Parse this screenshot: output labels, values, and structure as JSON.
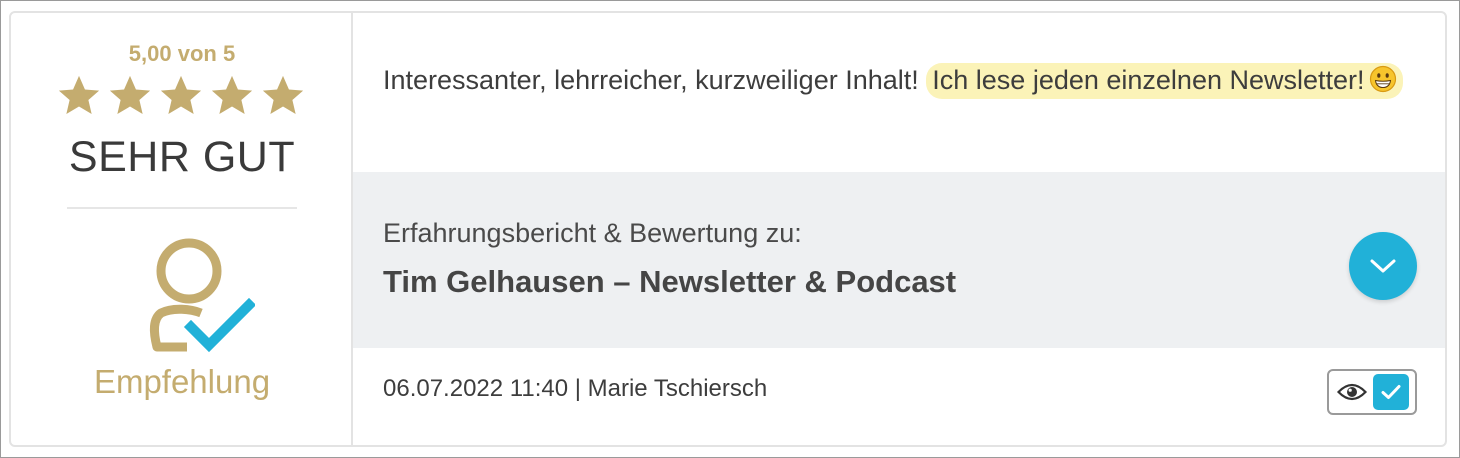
{
  "rating": {
    "score_text": "5,00 von 5",
    "stars_filled": 5,
    "stars_total": 5,
    "verdict": "SEHR GUT",
    "recommendation_icon": "user-check-icon",
    "recommendation_label": "Empfehlung"
  },
  "review": {
    "text_plain": "Interessanter, lehrreicher, kurzweiliger Inhalt! ",
    "text_highlight": "Ich lese jeden einzelnen Newsletter!",
    "emoji": "grinning-face-emoji"
  },
  "about": {
    "label": "Erfahrungsbericht & Bewertung zu:",
    "title": "Tim Gelhausen – Newsletter & Podcast",
    "expand_icon": "chevron-down-icon"
  },
  "meta": {
    "date_author": "06.07.2022 11:40 | Marie Tschiersch",
    "view_icon": "eye-icon",
    "verified_icon": "checkmark-icon"
  },
  "colors": {
    "gold": "#c4ac6f",
    "accent": "#21b1d8",
    "highlight": "#fbf3b8",
    "panel": "#eef0f2"
  }
}
